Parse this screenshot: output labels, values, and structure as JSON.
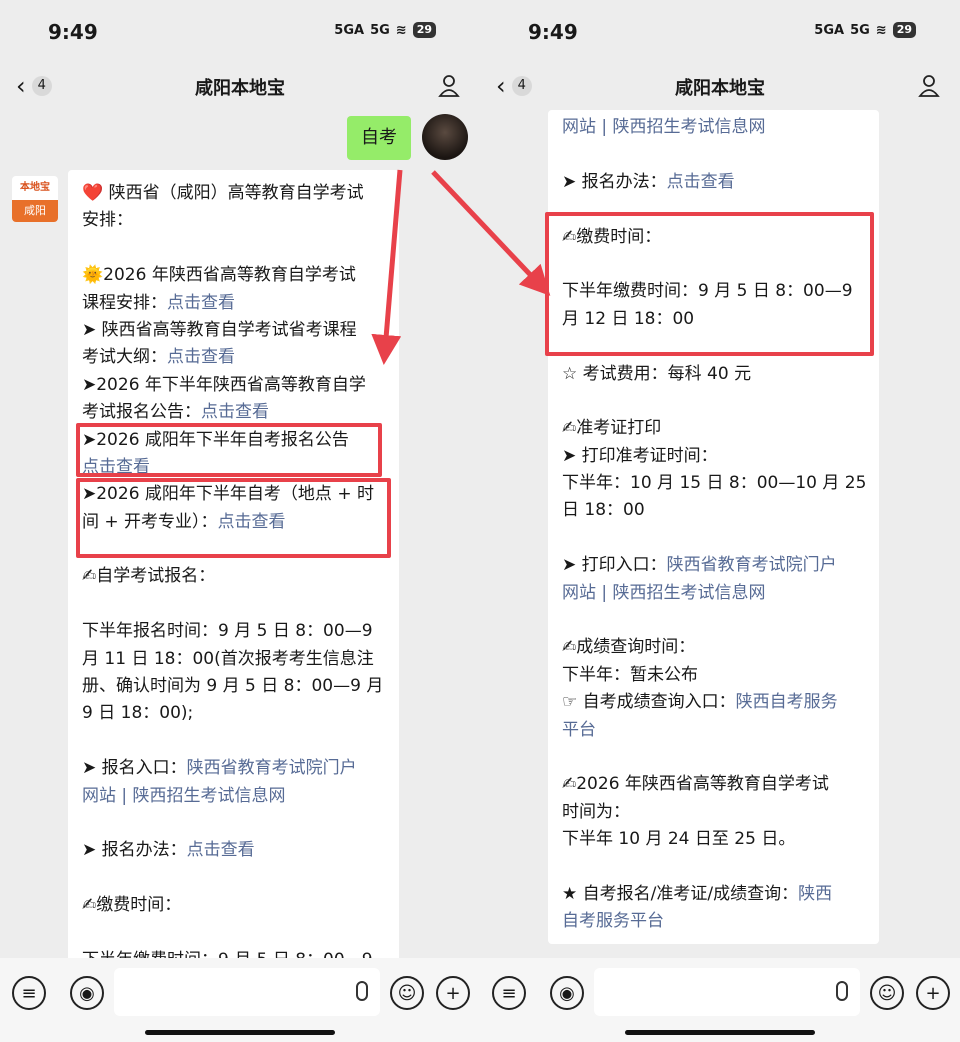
{
  "status": {
    "time": "9:49",
    "signal1": "5GA",
    "signal2": "5G",
    "battery": "29"
  },
  "header": {
    "back_count": "4",
    "title": "咸阳本地宝"
  },
  "chat": {
    "self_message": "自考",
    "bot_avatar_top": "本地宝",
    "bot_avatar_bottom": "咸阳"
  },
  "left_lines": [
    {
      "t": "❤️ 陕西省（咸阳）高等教育自学考试"
    },
    {
      "t": "安排："
    },
    {
      "t": ""
    },
    {
      "t": "🌞2026 年陕西省高等教育自学考试"
    },
    {
      "t": "课程安排：",
      "l": "点击查看"
    },
    {
      "t": "➤ 陕西省高等教育自学考试省考课程"
    },
    {
      "t": "考试大纲：",
      "l": "点击查看"
    },
    {
      "t": "➤2026 年下半年陕西省高等教育自学"
    },
    {
      "t": "考试报名公告：",
      "l": "点击查看"
    },
    {
      "t": "➤2026 咸阳年下半年自考报名公告"
    },
    {
      "t": "",
      "l": "点击查看"
    },
    {
      "t": "➤2026 咸阳年下半年自考（地点 + 时"
    },
    {
      "t": "间 + 开考专业）：",
      "l": "点击查看"
    },
    {
      "t": ""
    },
    {
      "t": "✍自学考试报名："
    },
    {
      "t": ""
    },
    {
      "t": "下半年报名时间：9 月 5 日 8：00—9"
    },
    {
      "t": "月 11 日 18：00(首次报考考生信息注"
    },
    {
      "t": "册、确认时间为 9 月 5 日 8：00—9 月"
    },
    {
      "t": "9 日 18：00);"
    },
    {
      "t": ""
    },
    {
      "t": "➤ 报名入口：",
      "l": "陕西省教育考试院门户"
    },
    {
      "t": "",
      "l": "网站 | 陕西招生考试信息网"
    },
    {
      "t": ""
    },
    {
      "t": "➤ 报名办法：",
      "l": "点击查看"
    },
    {
      "t": ""
    },
    {
      "t": "✍缴费时间："
    },
    {
      "t": ""
    },
    {
      "t": "下半年缴费时间：9 月 5 日 8：00—9"
    }
  ],
  "right_lines": [
    {
      "t": "",
      "l": "网站 | 陕西招生考试信息网"
    },
    {
      "t": ""
    },
    {
      "t": "➤ 报名办法：",
      "l": "点击查看"
    },
    {
      "t": ""
    },
    {
      "t": "✍缴费时间："
    },
    {
      "t": ""
    },
    {
      "t": "下半年缴费时间：9 月 5 日 8：00—9"
    },
    {
      "t": "月 12 日 18：00"
    },
    {
      "t": ""
    },
    {
      "t": "☆ 考试费用：每科 40 元"
    },
    {
      "t": ""
    },
    {
      "t": "✍准考证打印"
    },
    {
      "t": "➤ 打印准考证时间："
    },
    {
      "t": "下半年：10 月 15 日 8：00—10 月 25"
    },
    {
      "t": "日 18：00"
    },
    {
      "t": ""
    },
    {
      "t": "➤ 打印入口：",
      "l": "陕西省教育考试院门户"
    },
    {
      "t": "",
      "l": "网站 | 陕西招生考试信息网"
    },
    {
      "t": ""
    },
    {
      "t": "✍成绩查询时间："
    },
    {
      "t": "下半年：暂未公布"
    },
    {
      "t": "☞ 自考成绩查询入口：",
      "l": "陕西自考服务"
    },
    {
      "t": "",
      "l": "平台"
    },
    {
      "t": ""
    },
    {
      "t": "✍2026 年陕西省高等教育自学考试"
    },
    {
      "t": "时间为："
    },
    {
      "t": "下半年 10 月 24 日至 25 日。"
    },
    {
      "t": ""
    },
    {
      "t": "★ 自考报名/准考证/成绩查询：",
      "l": "陕西"
    },
    {
      "t": "",
      "l": "自考服务平台"
    }
  ],
  "colors": {
    "accent_link": "#576b95",
    "highlight": "#e8414a",
    "self_bubble": "#95ec69"
  },
  "icons": [
    "list-icon",
    "voice-icon",
    "mic-icon",
    "emoji-icon",
    "plus-icon",
    "user-icon",
    "back-icon"
  ]
}
